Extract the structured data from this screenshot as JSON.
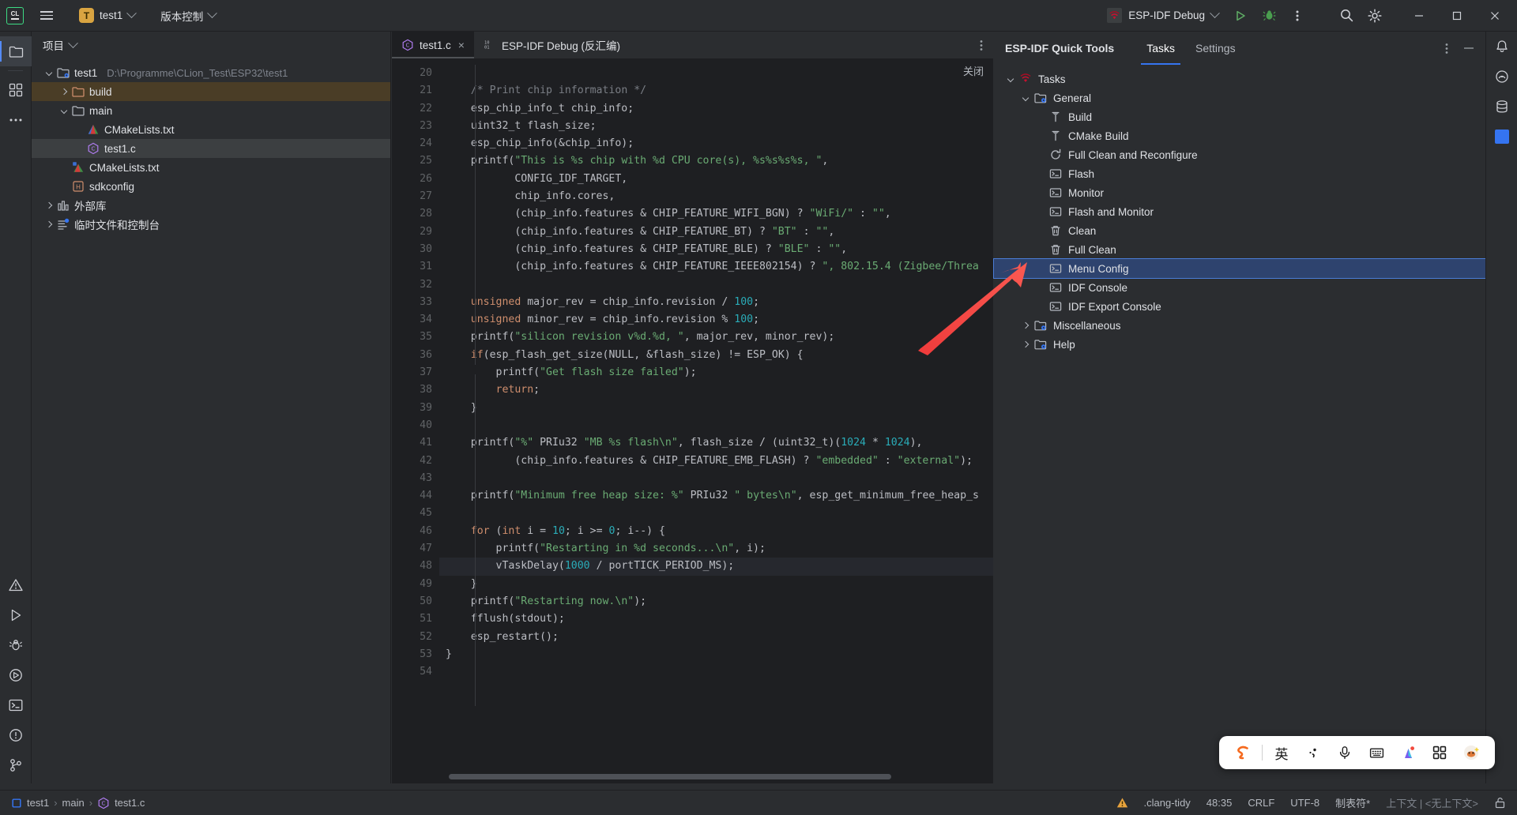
{
  "toolbar": {
    "logo_text": "CL",
    "menu_label": "main-menu",
    "project_badge": "T",
    "project_name": "test1",
    "vcs_label": "版本控制",
    "run_config": "ESP-IDF Debug",
    "run_label": "run-button",
    "debug_label": "debug-button",
    "more_label": "更多",
    "search_label": "search",
    "settings_label": "settings"
  },
  "project_panel": {
    "title": "项目",
    "tree": [
      {
        "label": "test1",
        "path": "D:\\Programme\\CLion_Test\\ESP32\\test1",
        "icon": "project-folder-icon",
        "indent": 0,
        "arrow": "open",
        "state": "normal"
      },
      {
        "label": "build",
        "path": "",
        "icon": "folder-orange-icon",
        "indent": 1,
        "arrow": "closed",
        "state": "highlight"
      },
      {
        "label": "main",
        "path": "",
        "icon": "folder-icon",
        "indent": 1,
        "arrow": "open",
        "state": "normal"
      },
      {
        "label": "CMakeLists.txt",
        "path": "",
        "icon": "cmake-icon",
        "indent": 2,
        "arrow": "none",
        "state": "normal"
      },
      {
        "label": "test1.c",
        "path": "",
        "icon": "c-file-icon",
        "indent": 2,
        "arrow": "none",
        "state": "selected"
      },
      {
        "label": "CMakeLists.txt",
        "path": "",
        "icon": "cmake-root-icon",
        "indent": 1,
        "arrow": "none",
        "state": "normal"
      },
      {
        "label": "sdkconfig",
        "path": "",
        "icon": "header-file-icon",
        "indent": 1,
        "arrow": "none",
        "state": "normal"
      },
      {
        "label": "外部库",
        "path": "",
        "icon": "library-icon",
        "indent": 0,
        "arrow": "closed",
        "state": "normal"
      },
      {
        "label": "临时文件和控制台",
        "path": "",
        "icon": "scratches-icon",
        "indent": 0,
        "arrow": "closed",
        "state": "normal"
      }
    ]
  },
  "editor": {
    "tabs": [
      {
        "label": "test1.c",
        "icon": "c-file-icon",
        "active": true,
        "closable": true
      },
      {
        "label": "ESP-IDF Debug (反汇编)",
        "icon": "disassembly-icon",
        "active": false,
        "closable": false
      }
    ],
    "close_link": "关闭",
    "first_line_number": 20,
    "current_line": 48,
    "lines": [
      {
        "n": 20,
        "tokens": []
      },
      {
        "n": 21,
        "tokens": [
          {
            "t": "    ",
            "c": "plain"
          },
          {
            "t": "/* Print chip information */",
            "c": "cmt"
          }
        ]
      },
      {
        "n": 22,
        "tokens": [
          {
            "t": "    esp_chip_info_t chip_info;",
            "c": "plain"
          }
        ]
      },
      {
        "n": 23,
        "tokens": [
          {
            "t": "    uint32_t flash_size;",
            "c": "plain"
          }
        ]
      },
      {
        "n": 24,
        "tokens": [
          {
            "t": "    esp_chip_info(&chip_info);",
            "c": "plain"
          }
        ]
      },
      {
        "n": 25,
        "tokens": [
          {
            "t": "    printf(",
            "c": "plain"
          },
          {
            "t": "\"This is %s chip with %d CPU core(s), %s%s%s%s, \"",
            "c": "str"
          },
          {
            "t": ",",
            "c": "plain"
          }
        ]
      },
      {
        "n": 26,
        "tokens": [
          {
            "t": "           CONFIG_IDF_TARGET,",
            "c": "plain"
          }
        ]
      },
      {
        "n": 27,
        "tokens": [
          {
            "t": "           chip_info.cores,",
            "c": "plain"
          }
        ]
      },
      {
        "n": 28,
        "tokens": [
          {
            "t": "           (chip_info.features & CHIP_FEATURE_WIFI_BGN) ? ",
            "c": "plain"
          },
          {
            "t": "\"WiFi/\"",
            "c": "str"
          },
          {
            "t": " : ",
            "c": "plain"
          },
          {
            "t": "\"\"",
            "c": "str"
          },
          {
            "t": ",",
            "c": "plain"
          }
        ]
      },
      {
        "n": 29,
        "tokens": [
          {
            "t": "           (chip_info.features & CHIP_FEATURE_BT) ? ",
            "c": "plain"
          },
          {
            "t": "\"BT\"",
            "c": "str"
          },
          {
            "t": " : ",
            "c": "plain"
          },
          {
            "t": "\"\"",
            "c": "str"
          },
          {
            "t": ",",
            "c": "plain"
          }
        ]
      },
      {
        "n": 30,
        "tokens": [
          {
            "t": "           (chip_info.features & CHIP_FEATURE_BLE) ? ",
            "c": "plain"
          },
          {
            "t": "\"BLE\"",
            "c": "str"
          },
          {
            "t": " : ",
            "c": "plain"
          },
          {
            "t": "\"\"",
            "c": "str"
          },
          {
            "t": ",",
            "c": "plain"
          }
        ]
      },
      {
        "n": 31,
        "tokens": [
          {
            "t": "           (chip_info.features & CHIP_FEATURE_IEEE802154) ? ",
            "c": "plain"
          },
          {
            "t": "\", 802.15.4 (Zigbee/Threa",
            "c": "str"
          }
        ]
      },
      {
        "n": 32,
        "tokens": []
      },
      {
        "n": 33,
        "tokens": [
          {
            "t": "    ",
            "c": "plain"
          },
          {
            "t": "unsigned",
            "c": "kw"
          },
          {
            "t": " major_rev = chip_info.revision / ",
            "c": "plain"
          },
          {
            "t": "100",
            "c": "num"
          },
          {
            "t": ";",
            "c": "plain"
          }
        ]
      },
      {
        "n": 34,
        "tokens": [
          {
            "t": "    ",
            "c": "plain"
          },
          {
            "t": "unsigned",
            "c": "kw"
          },
          {
            "t": " minor_rev = chip_info.revision % ",
            "c": "plain"
          },
          {
            "t": "100",
            "c": "num"
          },
          {
            "t": ";",
            "c": "plain"
          }
        ]
      },
      {
        "n": 35,
        "tokens": [
          {
            "t": "    printf(",
            "c": "plain"
          },
          {
            "t": "\"silicon revision v%d.%d, \"",
            "c": "str"
          },
          {
            "t": ", major_rev, minor_rev);",
            "c": "plain"
          }
        ]
      },
      {
        "n": 36,
        "tokens": [
          {
            "t": "    ",
            "c": "plain"
          },
          {
            "t": "if",
            "c": "kw"
          },
          {
            "t": "(esp_flash_get_size(NULL, &flash_size) != ESP_OK) {",
            "c": "plain"
          }
        ]
      },
      {
        "n": 37,
        "tokens": [
          {
            "t": "        printf(",
            "c": "plain"
          },
          {
            "t": "\"Get flash size failed\"",
            "c": "str"
          },
          {
            "t": ");",
            "c": "plain"
          }
        ]
      },
      {
        "n": 38,
        "tokens": [
          {
            "t": "        ",
            "c": "plain"
          },
          {
            "t": "return",
            "c": "kw"
          },
          {
            "t": ";",
            "c": "plain"
          }
        ]
      },
      {
        "n": 39,
        "tokens": [
          {
            "t": "    }",
            "c": "plain"
          }
        ]
      },
      {
        "n": 40,
        "tokens": []
      },
      {
        "n": 41,
        "tokens": [
          {
            "t": "    printf(",
            "c": "plain"
          },
          {
            "t": "\"%\"",
            "c": "str"
          },
          {
            "t": " PRIu32 ",
            "c": "plain"
          },
          {
            "t": "\"MB %s flash\\n\"",
            "c": "str"
          },
          {
            "t": ", flash_size / (uint32_t)(",
            "c": "plain"
          },
          {
            "t": "1024",
            "c": "num"
          },
          {
            "t": " * ",
            "c": "plain"
          },
          {
            "t": "1024",
            "c": "num"
          },
          {
            "t": "),",
            "c": "plain"
          }
        ]
      },
      {
        "n": 42,
        "tokens": [
          {
            "t": "           (chip_info.features & CHIP_FEATURE_EMB_FLASH) ? ",
            "c": "plain"
          },
          {
            "t": "\"embedded\"",
            "c": "str"
          },
          {
            "t": " : ",
            "c": "plain"
          },
          {
            "t": "\"external\"",
            "c": "str"
          },
          {
            "t": ");",
            "c": "plain"
          }
        ]
      },
      {
        "n": 43,
        "tokens": []
      },
      {
        "n": 44,
        "tokens": [
          {
            "t": "    printf(",
            "c": "plain"
          },
          {
            "t": "\"Minimum free heap size: %\"",
            "c": "str"
          },
          {
            "t": " PRIu32 ",
            "c": "plain"
          },
          {
            "t": "\" bytes\\n\"",
            "c": "str"
          },
          {
            "t": ", esp_get_minimum_free_heap_s",
            "c": "plain"
          }
        ]
      },
      {
        "n": 45,
        "tokens": []
      },
      {
        "n": 46,
        "tokens": [
          {
            "t": "    ",
            "c": "plain"
          },
          {
            "t": "for",
            "c": "kw"
          },
          {
            "t": " (",
            "c": "plain"
          },
          {
            "t": "int",
            "c": "kw"
          },
          {
            "t": " i = ",
            "c": "plain"
          },
          {
            "t": "10",
            "c": "num"
          },
          {
            "t": "; i >= ",
            "c": "plain"
          },
          {
            "t": "0",
            "c": "num"
          },
          {
            "t": "; i--) {",
            "c": "plain"
          }
        ]
      },
      {
        "n": 47,
        "tokens": [
          {
            "t": "        printf(",
            "c": "plain"
          },
          {
            "t": "\"Restarting in %d seconds...\\n\"",
            "c": "str"
          },
          {
            "t": ", i);",
            "c": "plain"
          }
        ]
      },
      {
        "n": 48,
        "tokens": [
          {
            "t": "        vTaskDelay(",
            "c": "plain"
          },
          {
            "t": "1000",
            "c": "num"
          },
          {
            "t": " / portTICK_PERIOD_MS);",
            "c": "plain"
          }
        ]
      },
      {
        "n": 49,
        "tokens": [
          {
            "t": "    }",
            "c": "plain"
          }
        ]
      },
      {
        "n": 50,
        "tokens": [
          {
            "t": "    printf(",
            "c": "plain"
          },
          {
            "t": "\"Restarting now.\\n\"",
            "c": "str"
          },
          {
            "t": ");",
            "c": "plain"
          }
        ]
      },
      {
        "n": 51,
        "tokens": [
          {
            "t": "    fflush(stdout);",
            "c": "plain"
          }
        ]
      },
      {
        "n": 52,
        "tokens": [
          {
            "t": "    esp_restart();",
            "c": "plain"
          }
        ]
      },
      {
        "n": 53,
        "tokens": [
          {
            "t": "}",
            "c": "plain"
          }
        ]
      },
      {
        "n": 54,
        "tokens": []
      }
    ]
  },
  "quick_tools": {
    "title": "ESP-IDF Quick Tools",
    "tabs": [
      {
        "label": "Tasks",
        "active": true
      },
      {
        "label": "Settings",
        "active": false
      }
    ],
    "tree": [
      {
        "label": "Tasks",
        "icon": "esp-logo-icon",
        "indent": 0,
        "arrow": "open",
        "selected": false
      },
      {
        "label": "General",
        "icon": "folder-config-icon",
        "indent": 1,
        "arrow": "open",
        "selected": false
      },
      {
        "label": "Build",
        "icon": "hammer-icon",
        "indent": 2,
        "arrow": "none",
        "selected": false
      },
      {
        "label": "CMake Build",
        "icon": "hammer-icon",
        "indent": 2,
        "arrow": "none",
        "selected": false
      },
      {
        "label": "Full Clean and Reconfigure",
        "icon": "refresh-icon",
        "indent": 2,
        "arrow": "none",
        "selected": false
      },
      {
        "label": "Flash",
        "icon": "terminal-icon",
        "indent": 2,
        "arrow": "none",
        "selected": false
      },
      {
        "label": "Monitor",
        "icon": "terminal-icon",
        "indent": 2,
        "arrow": "none",
        "selected": false
      },
      {
        "label": "Flash and Monitor",
        "icon": "terminal-icon",
        "indent": 2,
        "arrow": "none",
        "selected": false
      },
      {
        "label": "Clean",
        "icon": "trash-icon",
        "indent": 2,
        "arrow": "none",
        "selected": false
      },
      {
        "label": "Full Clean",
        "icon": "trash-icon",
        "indent": 2,
        "arrow": "none",
        "selected": false
      },
      {
        "label": "Menu Config",
        "icon": "terminal-icon",
        "indent": 2,
        "arrow": "none",
        "selected": true
      },
      {
        "label": "IDF Console",
        "icon": "terminal-icon",
        "indent": 2,
        "arrow": "none",
        "selected": false
      },
      {
        "label": "IDF Export Console",
        "icon": "terminal-icon",
        "indent": 2,
        "arrow": "none",
        "selected": false
      },
      {
        "label": "Miscellaneous",
        "icon": "folder-config-icon",
        "indent": 1,
        "arrow": "closed",
        "selected": false
      },
      {
        "label": "Help",
        "icon": "folder-config-icon",
        "indent": 1,
        "arrow": "closed",
        "selected": false
      }
    ]
  },
  "status_bar": {
    "breadcrumb": [
      {
        "label": "test1",
        "icon": "module-icon"
      },
      {
        "label": "main",
        "icon": "none"
      },
      {
        "label": "test1.c",
        "icon": "c-file-icon"
      }
    ],
    "inspection": ".clang-tidy",
    "caret": "48:35",
    "line_sep": "CRLF",
    "encoding": "UTF-8",
    "indent": "制表符*",
    "context": "上下文 | <无上下文>",
    "warning_icon": "warning-icon",
    "lock_icon": "unlocked-icon"
  },
  "ime_bar": {
    "logo": "sogou-logo",
    "mode": "英",
    "items": [
      "punctuation-icon",
      "microphone-icon",
      "keyboard-icon",
      "colorpicker-icon",
      "apps-icon",
      "avatar-icon"
    ]
  },
  "colors": {
    "accent": "#3574f0",
    "selection": "#2e436e",
    "bg": "#2b2d30",
    "editor_bg": "#1e1f22",
    "arrow": "#f04438"
  }
}
